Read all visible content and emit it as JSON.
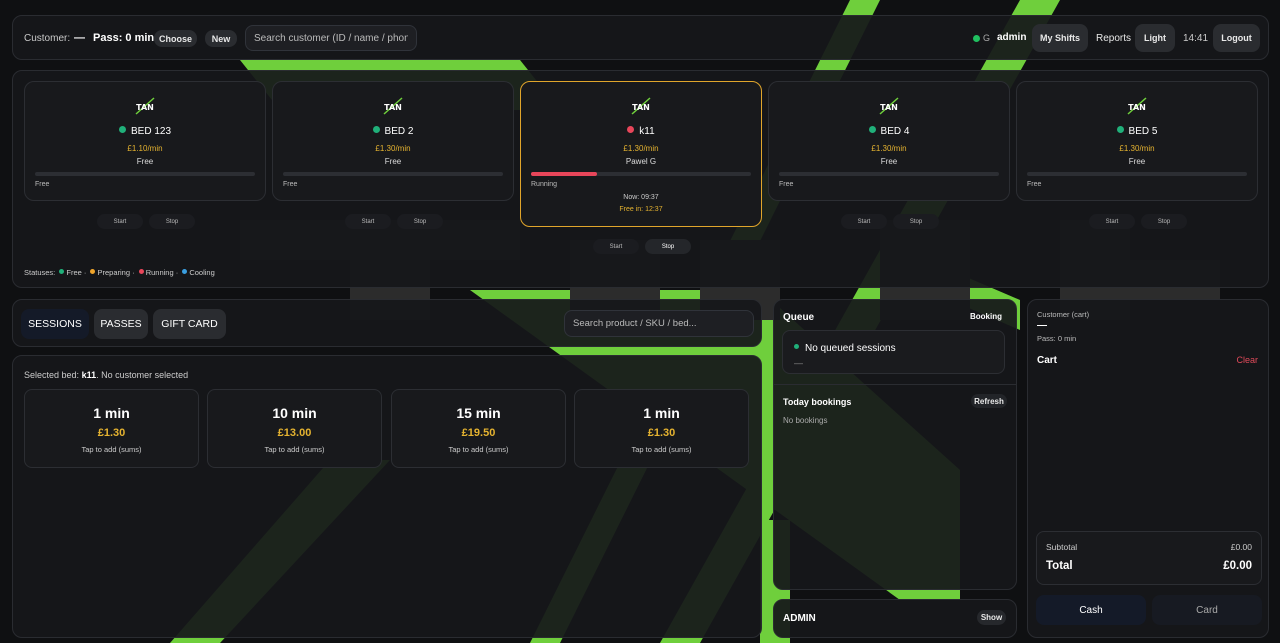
{
  "colors": {
    "accent_green": "#6fcf3c",
    "free": "#20b07a",
    "preparing": "#f0a52b",
    "running": "#e8465a",
    "cooling": "#3a9ee0",
    "price": "#e5b330",
    "clear": "#e04a5a"
  },
  "topbar": {
    "customer_label": "Customer:",
    "customer_value": "—",
    "pass_text": "Pass: 0 min",
    "choose_label": "Choose",
    "new_label": "New",
    "search_placeholder": "Search customer (ID / name / phone ...",
    "status_letter": "G",
    "user": "admin",
    "my_shifts_label": "My Shifts",
    "reports_label": "Reports",
    "theme_label": "Light",
    "time": "14:41",
    "logout_label": "Logout"
  },
  "beds": [
    {
      "name": "BED 123",
      "status": "free",
      "price": "£1.10/min",
      "sub": "Free",
      "state": "Free",
      "start": "Start",
      "stop": "Stop"
    },
    {
      "name": "BED 2",
      "status": "free",
      "price": "£1.30/min",
      "sub": "Free",
      "state": "Free",
      "start": "Start",
      "stop": "Stop"
    },
    {
      "name": "k11",
      "status": "running",
      "price": "£1.30/min",
      "sub": "Pawel G",
      "state": "Running",
      "progress": 0.3,
      "now": "Now: 09:37",
      "free_in": "Free in: 12:37",
      "start": "Start",
      "stop": "Stop"
    },
    {
      "name": "BED 4",
      "status": "free",
      "price": "£1.30/min",
      "sub": "Free",
      "state": "Free",
      "start": "Start",
      "stop": "Stop"
    },
    {
      "name": "BED 5",
      "status": "free",
      "price": "£1.30/min",
      "sub": "Free",
      "state": "Free",
      "start": "Start",
      "stop": "Stop"
    }
  ],
  "bed_logo_text": "TAN",
  "statuses": {
    "label": "Statuses:",
    "items": [
      "Free",
      "Preparing",
      "Running",
      "Cooling"
    ],
    "sep": "·"
  },
  "tabs": {
    "sessions": "SESSIONS",
    "passes": "PASSES",
    "gift_card": "GIFT CARD",
    "search_placeholder": "Search product / SKU / bed..."
  },
  "products": {
    "selected_prefix": "Selected bed:",
    "selected_bed": "k11",
    "selected_suffix": ". No customer selected",
    "items": [
      {
        "title": "1 min",
        "price": "£1.30",
        "hint": "Tap to add (sums)"
      },
      {
        "title": "10 min",
        "price": "£13.00",
        "hint": "Tap to add (sums)"
      },
      {
        "title": "15 min",
        "price": "£19.50",
        "hint": "Tap to add (sums)"
      },
      {
        "title": "1 min",
        "price": "£1.30",
        "hint": "Tap to add (sums)"
      }
    ]
  },
  "queue": {
    "title": "Queue",
    "booking_label": "Booking",
    "empty_message": "No queued sessions",
    "empty_dash": "—",
    "today_title": "Today bookings",
    "refresh_label": "Refresh",
    "no_bookings": "No bookings"
  },
  "admin": {
    "title": "ADMIN",
    "show_label": "Show"
  },
  "cart": {
    "customer_label": "Customer (cart)",
    "customer_value": "—",
    "pass_text": "Pass: 0 min",
    "title": "Cart",
    "clear_label": "Clear",
    "subtotal_label": "Subtotal",
    "subtotal_value": "£0.00",
    "total_label": "Total",
    "total_value": "£0.00",
    "cash_label": "Cash",
    "card_label": "Card"
  }
}
